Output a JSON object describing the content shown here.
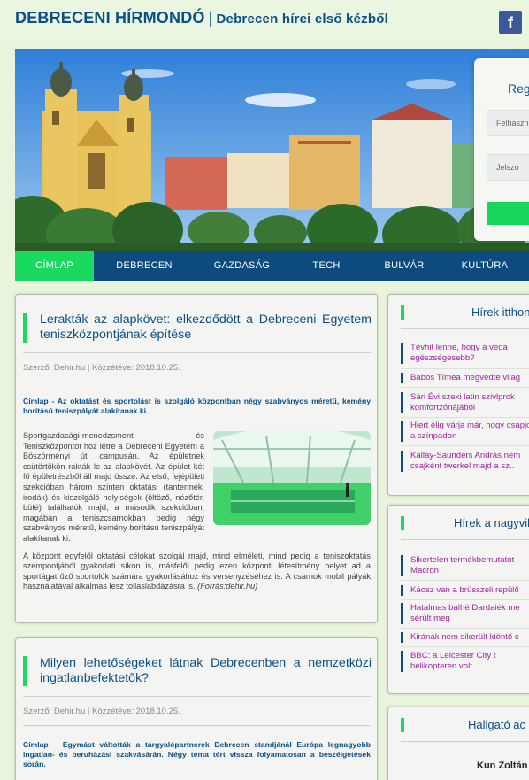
{
  "header": {
    "site_name": "DEBRECENI HÍRMONDÓ",
    "separator": "|",
    "tagline": "Debrecen hírei első kézből",
    "facebook_icon_text": "f"
  },
  "login": {
    "title": "Reg",
    "username_placeholder": "Felhaszn",
    "password_placeholder": "Jelszó"
  },
  "nav": {
    "items": [
      {
        "label": "CÍMLAP",
        "active": true
      },
      {
        "label": "DEBRECEN",
        "active": false
      },
      {
        "label": "GAZDASÁG",
        "active": false
      },
      {
        "label": "TECH",
        "active": false
      },
      {
        "label": "BULVÁR",
        "active": false
      },
      {
        "label": "KULTÚRA",
        "active": false
      }
    ]
  },
  "articles": [
    {
      "title": "Lerakták az alapkövet: elkezdődött a Debreceni Egyetem teniszközpontjának építése",
      "meta": "Szerző: Dehir.hu | Közzétéve: 2018.10.25.",
      "lead": "Címlap - Az oktatást és sportolást is szolgáló központban négy szabványos méretű, kemény borítású teniszpályát alakítanak ki.",
      "body1": "Sportgazdasági-menedzsment és Teniszközpontot hoz létre a Debreceni Egyetem a Böszörményi úti campusán. Az épületnek csütörtökön rakták le az alapkövét. Az épület két fő épületrészből áll majd össze. Az első, fejépületi szekcióban három színten oktatási (tantermek, irodák) és kiszolgáló helyiségek (öltöző, nézőtér, büfé) találhatók majd, a második szekcióban, magában a teniszcsarnokban pedig négy szabványos méretű, kemény borítású teniszpályát alakítanak ki.",
      "body2": "A központ egyfelől oktatási célokat szolgál majd, mind elméleti, mind pedig a teniszoktatás szempontjából gyakorlati síkon is, másfelől pedig ezen központi létesítmény helyet ad a sportágat űző sportolók számára gyakorlásához és versenyzéséhez is. A csarnok mobil pályák használatával alkalmas lesz tollaslabdázásra is.",
      "source": "(Forrás:dehir.hu)"
    },
    {
      "title": "Milyen lehetőségeket látnak Debrecenben a nemzetközi ingatlanbefektetők?",
      "meta": "Szerző: Dehir.hu | Közzétéve: 2018.10.25.",
      "lead": "Címlap – Egymást váltották a tárgyalópartnerek Debrecen standjánál Európa legnagyobb ingatlan- és beruházási szakvásárán. Négy téma tért vissza folyamatosan a beszélgetések során."
    }
  ],
  "sidebar": {
    "home_news": {
      "heading": "Hírek itthon",
      "items": [
        "Tévhit lenne, hogy a vega egészségesebb?",
        "Babos Tímea megvédte vilag",
        "Sári Évi szexi latin szivlprok komfortzónájából",
        "Hiert élig várja már, hogy csapjon a színpadon",
        "Kállay-Saunders András nem csajként twerkel majd a sz.."
      ]
    },
    "world_news": {
      "heading": "Hírek a nagyvilág",
      "items": [
        "Sikertelen termékbemutatót Macron",
        "Káosz van a brüsszeli repülő",
        "Hatalmas balhé Dardaiék me sérült meg",
        "Kirának nem sikerült kiöntő c",
        "BBC: a Leicester City t helikopteren volt"
      ]
    },
    "student": {
      "heading": "Hallgató ac",
      "name": "Kun Zoltán"
    }
  },
  "colors": {
    "brand_blue": "#0a4f8a",
    "nav_bg": "#0d4a7e",
    "accent_green": "#19d95f",
    "link_purple": "#a61ea6",
    "page_bg": "#e8f5dc"
  }
}
